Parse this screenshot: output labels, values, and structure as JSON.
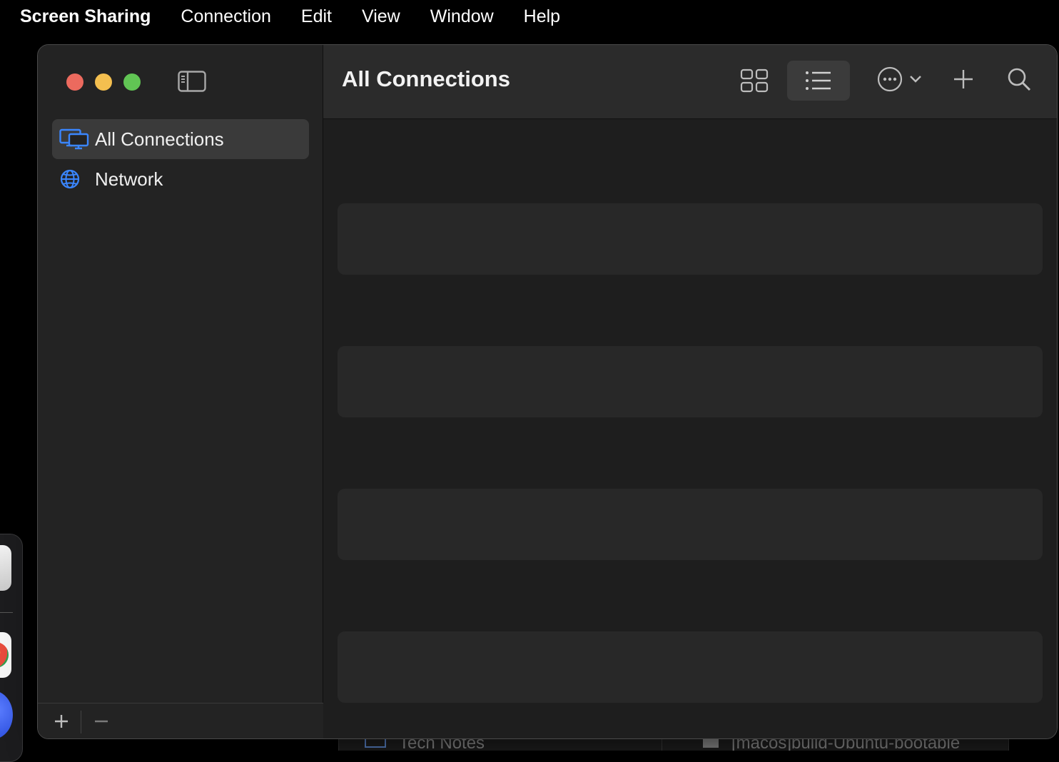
{
  "menubar": {
    "app_name": "Screen Sharing",
    "items": [
      "Connection",
      "Edit",
      "View",
      "Window",
      "Help"
    ]
  },
  "window": {
    "title": "All Connections"
  },
  "sidebar": {
    "items": [
      {
        "label": "All Connections",
        "icon": "monitors-icon",
        "selected": true
      },
      {
        "label": "Network",
        "icon": "globe-icon",
        "selected": false
      }
    ],
    "footer": {
      "add_icon": "plus-icon",
      "remove_icon": "minus-icon"
    }
  },
  "toolbar": {
    "view_modes": [
      "grid-view-icon",
      "list-view-icon"
    ],
    "active_view": "list",
    "more_icon": "ellipsis-circle-icon",
    "add_icon": "plus-icon",
    "search_icon": "search-icon"
  },
  "connections": {
    "placeholder_rows": 4
  },
  "background_window": {
    "left_text": "Tech Notes",
    "right_text": "[macos]build-Ubuntu-bootable"
  },
  "colors": {
    "accent": "#3a86ff",
    "close": "#ec6a5e",
    "minimize": "#f4bf4f",
    "maximize": "#61c554"
  }
}
